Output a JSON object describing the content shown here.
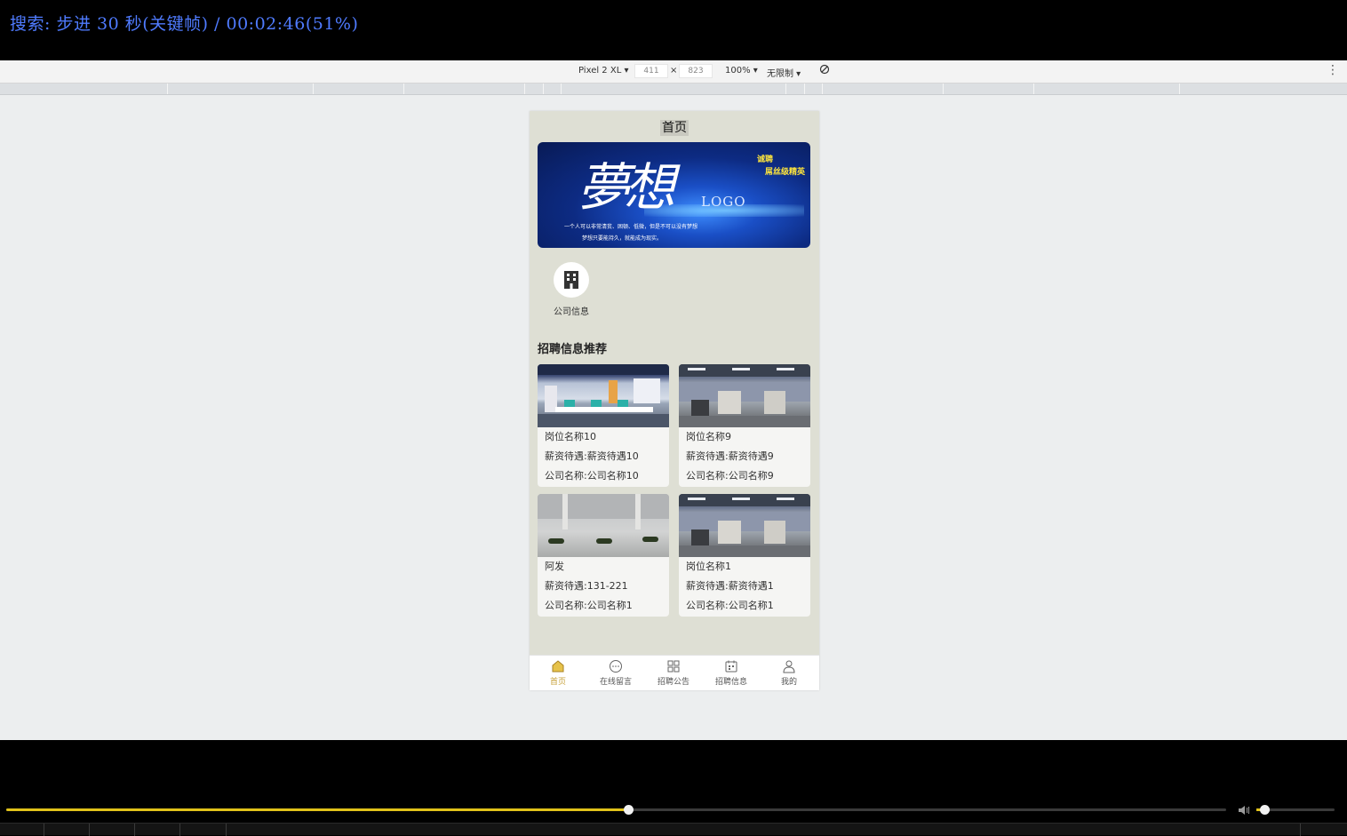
{
  "osd": {
    "text": "搜索: 步进 30 秒(关键帧) / 00:02:46(51%)"
  },
  "devtools": {
    "device": "Pixel 2 XL ▾",
    "width": "411",
    "times": "×",
    "height": "823",
    "zoom": "100% ▾",
    "throttle": "无限制 ▾",
    "more": "⋮"
  },
  "app": {
    "title": "首页",
    "banner": {
      "logo_text": "LOGO",
      "calligraphy": "夢想",
      "tag1": "诚聘",
      "tag2": "屌丝级精英",
      "line1": "一个人可以非常清贫、困顿、低微，但是不可以没有梦想",
      "line2": "梦想只要能持久，就能成为现实。"
    },
    "quick_entry": {
      "label": "公司信息"
    },
    "section_title": "招聘信息推荐",
    "jobs": [
      {
        "name": "岗位名称10",
        "salary": "薪资待遇:薪资待遇10",
        "company": "公司名称:公司名称10"
      },
      {
        "name": "岗位名称9",
        "salary": "薪资待遇:薪资待遇9",
        "company": "公司名称:公司名称9"
      },
      {
        "name": "阿发",
        "salary": "薪资待遇:131-221",
        "company": "公司名称:公司名称1"
      },
      {
        "name": "岗位名称1",
        "salary": "薪资待遇:薪资待遇1",
        "company": "公司名称:公司名称1"
      }
    ],
    "tabs": [
      {
        "label": "首页",
        "icon": "home-icon"
      },
      {
        "label": "在线留言",
        "icon": "chat-icon"
      },
      {
        "label": "招聘公告",
        "icon": "grid-icon"
      },
      {
        "label": "招聘信息",
        "icon": "calendar-icon"
      },
      {
        "label": "我的",
        "icon": "user-icon"
      }
    ],
    "accent_color": "#c7a13a"
  },
  "player": {
    "progress_fraction": 0.51,
    "volume_fraction": 0.1,
    "progress_color": "#e0c21a"
  }
}
